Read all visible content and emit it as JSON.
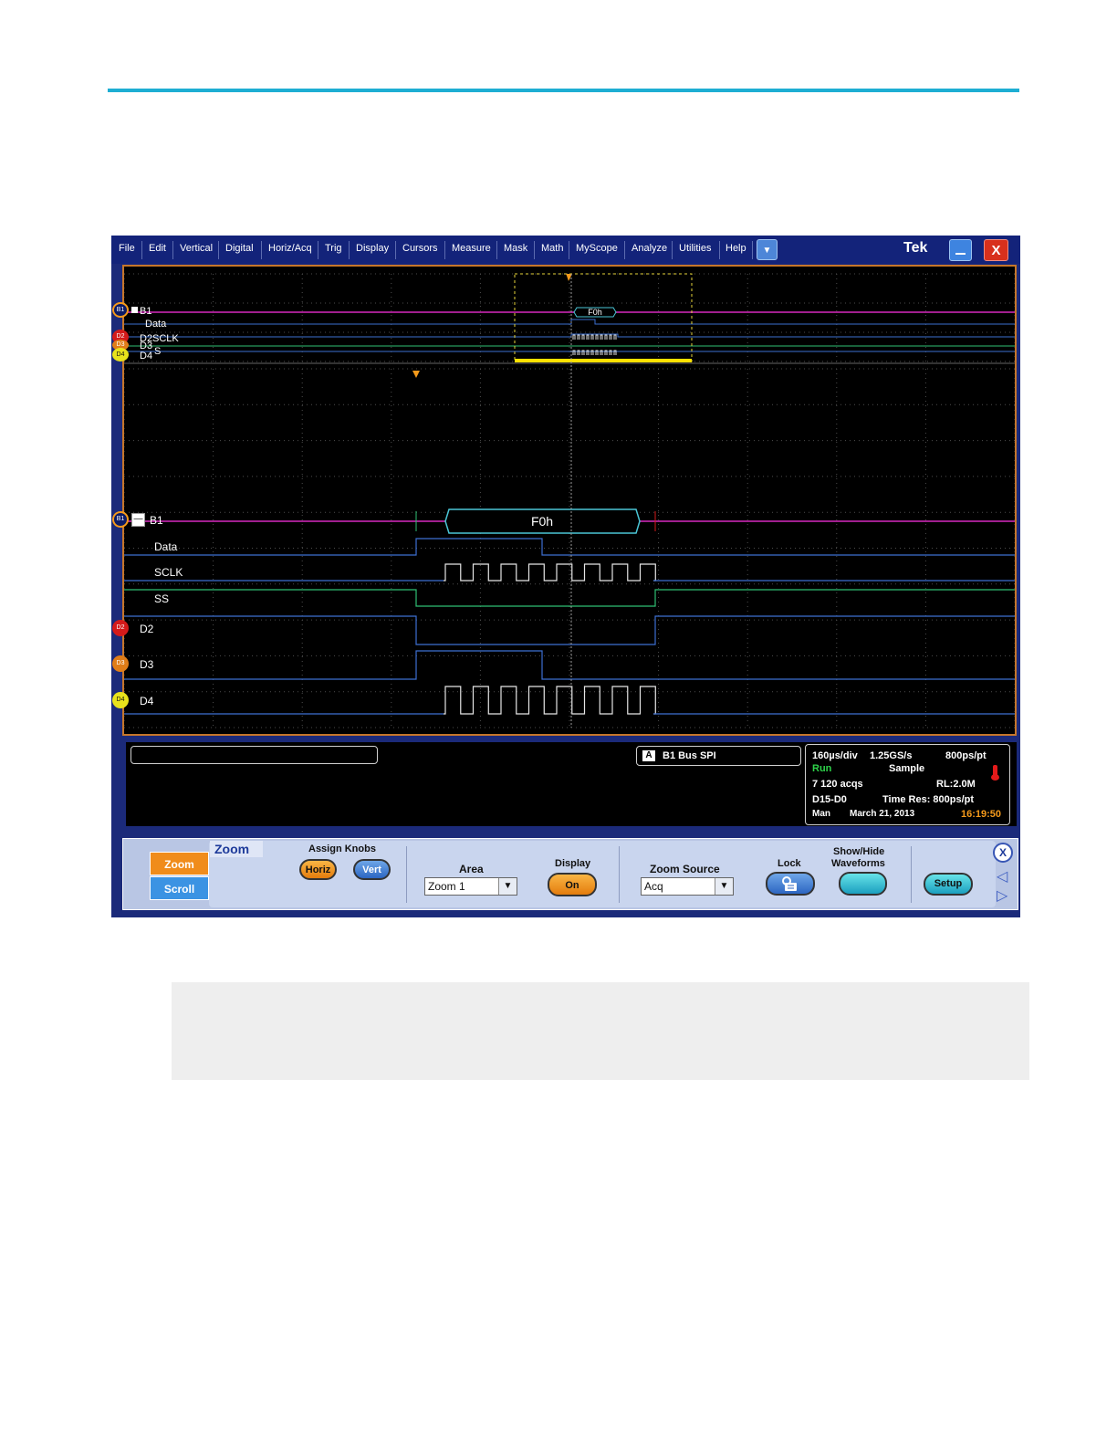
{
  "menubar": {
    "items": [
      "File",
      "Edit",
      "Vertical",
      "Digital",
      "Horiz/Acq",
      "Trig",
      "Display",
      "Cursors",
      "Measure",
      "Mask",
      "Math",
      "MyScope",
      "Analyze",
      "Utilities",
      "Help"
    ],
    "dropdown_icon": "chevron-down-icon",
    "brand": "Tek"
  },
  "overview": {
    "labels": {
      "b1": "B1",
      "data": "Data",
      "d2": "D2",
      "sclk": "SCLK",
      "d3": "D3",
      "ss": "S",
      "d4": "D4"
    },
    "badges": {
      "b1": "B1",
      "d2": "D2",
      "d3": "D3",
      "d4": "D4"
    },
    "bus_value": "F0h"
  },
  "zoomed": {
    "bus_label": "B1",
    "bus_value": "F0h",
    "collapse_symbol": "—",
    "traces": [
      {
        "label": "Data"
      },
      {
        "label": "SCLK"
      },
      {
        "label": "SS"
      },
      {
        "label": "D2",
        "badge": "D2",
        "color": "#d41a1a"
      },
      {
        "label": "D3",
        "badge": "D3",
        "color": "#e07d18"
      },
      {
        "label": "D4",
        "badge": "D4",
        "color": "#e8e21c"
      }
    ],
    "badge_b1": "B1"
  },
  "colors": {
    "bus": "#a11f8f",
    "data": "#3d6fd1",
    "logic": "#2fbf73",
    "grid": "#5a5a5a",
    "overview_box": "#e6d43a",
    "trigger": "#f59a1b"
  },
  "status": {
    "bus_badge": "A",
    "bus_text": "B1 Bus SPI",
    "acq": {
      "timebase": "160µs/div",
      "sample_rate": "1.25GS/s",
      "resolution": "800ps/pt",
      "state": "Run",
      "mode": "Sample",
      "acqs": "7 120 acqs",
      "record_length": "RL:2.0M",
      "channels": "D15-D0",
      "time_res": "Time Res: 800ps/pt",
      "trigger": "Man",
      "date": "March 21, 2013",
      "time": "16:19:50"
    }
  },
  "controls": {
    "side_tabs": [
      "Zoom",
      "Scroll"
    ],
    "title": "Zoom",
    "assign_knobs_label": "Assign Knobs",
    "horiz_label": "Horiz",
    "vert_label": "Vert",
    "area_label": "Area",
    "area_value": "Zoom 1",
    "display_label": "Display",
    "display_value": "On",
    "zoom_source_label": "Zoom Source",
    "zoom_source_value": "Acq",
    "lock_label": "Lock",
    "lock_icon": "lock-icon",
    "show_hide_label_1": "Show/Hide",
    "show_hide_label_2": "Waveforms",
    "setup_label": "Setup",
    "close_label": "X"
  }
}
